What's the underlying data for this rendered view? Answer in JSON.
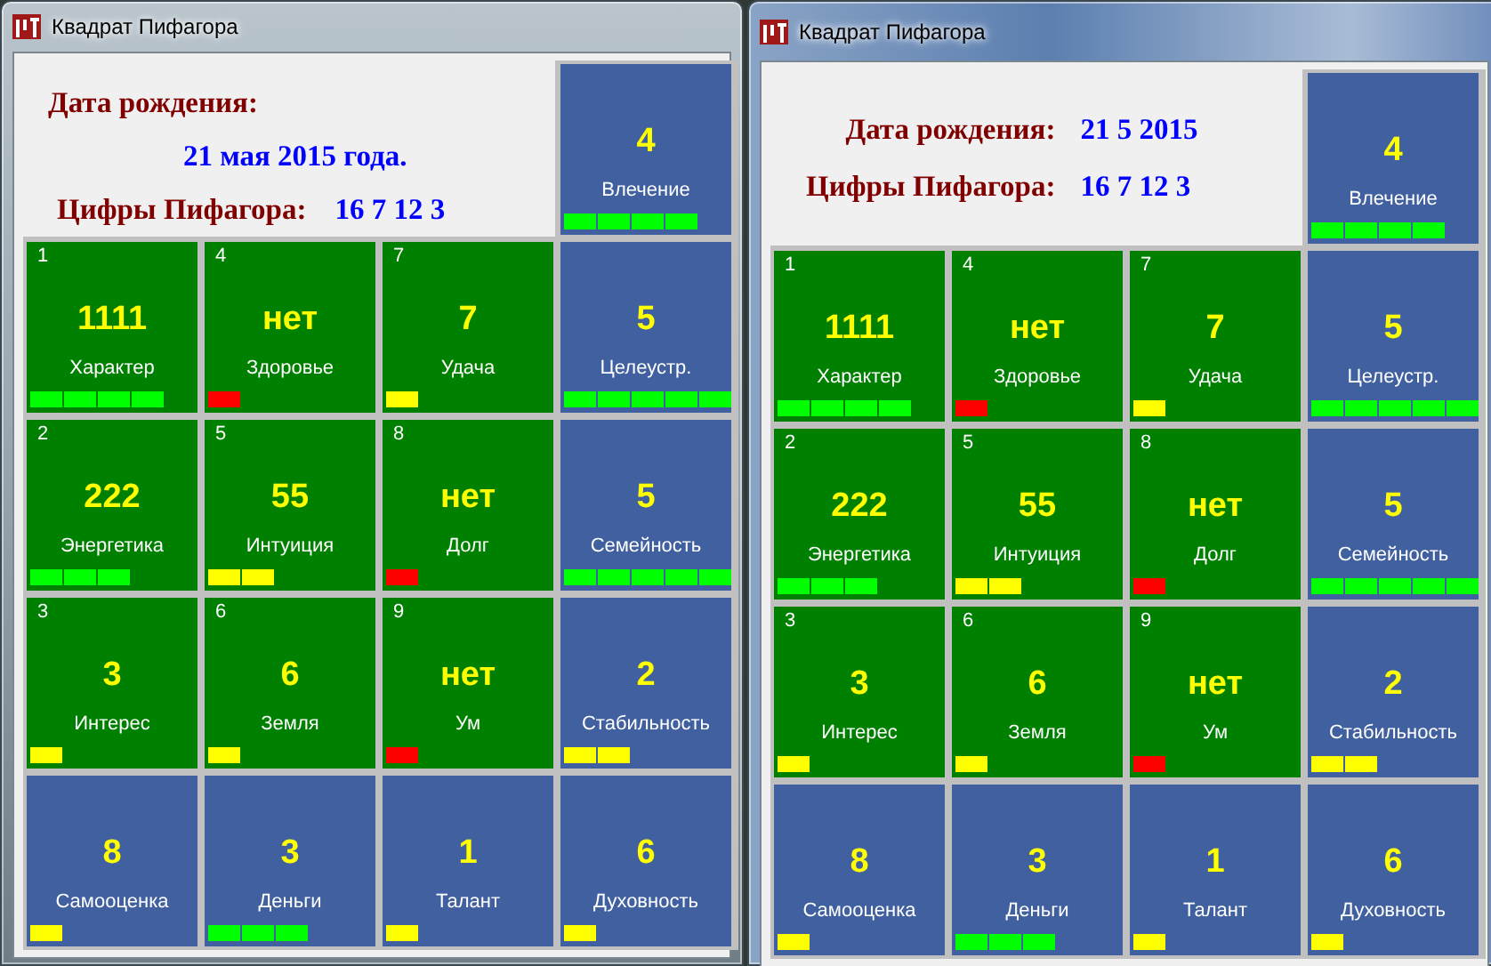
{
  "windows": [
    {
      "title": "Квадрат Пифагора",
      "active": false,
      "header": {
        "kind": "stacked",
        "birth_label": "Дата рождения:",
        "birth_value": "21 мая 2015 года.",
        "digits_label": "Цифры Пифагора:",
        "digits_value": "16 7 12 3"
      },
      "top_tile": {
        "kind": "extra",
        "value": "4",
        "label": "Влечение",
        "segments": [
          {
            "color": "#00ff00"
          },
          {
            "color": "#00ff00"
          },
          {
            "color": "#00ff00"
          },
          {
            "color": "#00ff00"
          }
        ]
      },
      "tiles": [
        {
          "kind": "matrix",
          "index": "1",
          "value": "1111",
          "label": "Характер",
          "segments": [
            {
              "color": "#00ff00"
            },
            {
              "color": "#00ff00"
            },
            {
              "color": "#00ff00"
            },
            {
              "color": "#00ff00"
            }
          ]
        },
        {
          "kind": "matrix",
          "index": "4",
          "value": "нет",
          "label": "Здоровье",
          "segments": [
            {
              "color": "#ff0000"
            }
          ]
        },
        {
          "kind": "matrix",
          "index": "7",
          "value": "7",
          "label": "Удача",
          "segments": [
            {
              "color": "#ffff00"
            }
          ]
        },
        {
          "kind": "extra",
          "value": "5",
          "label": "Целеустр.",
          "segments": [
            {
              "color": "#00ff00"
            },
            {
              "color": "#00ff00"
            },
            {
              "color": "#00ff00"
            },
            {
              "color": "#00ff00"
            },
            {
              "color": "#00ff00"
            }
          ]
        },
        {
          "kind": "matrix",
          "index": "2",
          "value": "222",
          "label": "Энергетика",
          "segments": [
            {
              "color": "#00ff00"
            },
            {
              "color": "#00ff00"
            },
            {
              "color": "#00ff00"
            }
          ]
        },
        {
          "kind": "matrix",
          "index": "5",
          "value": "55",
          "label": "Интуиция",
          "segments": [
            {
              "color": "#ffff00"
            },
            {
              "color": "#ffff00"
            }
          ]
        },
        {
          "kind": "matrix",
          "index": "8",
          "value": "нет",
          "label": "Долг",
          "segments": [
            {
              "color": "#ff0000"
            }
          ]
        },
        {
          "kind": "extra",
          "value": "5",
          "label": "Семейность",
          "segments": [
            {
              "color": "#00ff00"
            },
            {
              "color": "#00ff00"
            },
            {
              "color": "#00ff00"
            },
            {
              "color": "#00ff00"
            },
            {
              "color": "#00ff00"
            }
          ]
        },
        {
          "kind": "matrix",
          "index": "3",
          "value": "3",
          "label": "Интерес",
          "segments": [
            {
              "color": "#ffff00"
            }
          ]
        },
        {
          "kind": "matrix",
          "index": "6",
          "value": "6",
          "label": "Земля",
          "segments": [
            {
              "color": "#ffff00"
            }
          ]
        },
        {
          "kind": "matrix",
          "index": "9",
          "value": "нет",
          "label": "Ум",
          "segments": [
            {
              "color": "#ff0000"
            }
          ]
        },
        {
          "kind": "extra",
          "value": "2",
          "label": "Стабильность",
          "segments": [
            {
              "color": "#ffff00"
            },
            {
              "color": "#ffff00"
            }
          ]
        },
        {
          "kind": "extra",
          "value": "8",
          "label": "Самооценка",
          "segments": [
            {
              "color": "#ffff00"
            }
          ]
        },
        {
          "kind": "extra",
          "value": "3",
          "label": "Деньги",
          "segments": [
            {
              "color": "#00ff00"
            },
            {
              "color": "#00ff00"
            },
            {
              "color": "#00ff00"
            }
          ]
        },
        {
          "kind": "extra",
          "value": "1",
          "label": "Талант",
          "segments": [
            {
              "color": "#ffff00"
            }
          ]
        },
        {
          "kind": "extra",
          "value": "6",
          "label": "Духовность",
          "segments": [
            {
              "color": "#ffff00"
            }
          ]
        }
      ]
    },
    {
      "title": "Квадрат Пифагора",
      "active": true,
      "header": {
        "kind": "inline",
        "birth_label": "Дата рождения:",
        "birth_value": "21 5 2015",
        "digits_label": "Цифры Пифагора:",
        "digits_value": "16 7 12 3"
      },
      "top_tile": {
        "kind": "extra",
        "value": "4",
        "label": "Влечение",
        "segments": [
          {
            "color": "#00ff00"
          },
          {
            "color": "#00ff00"
          },
          {
            "color": "#00ff00"
          },
          {
            "color": "#00ff00"
          }
        ]
      },
      "tiles": [
        {
          "kind": "matrix",
          "index": "1",
          "value": "1111",
          "label": "Характер",
          "segments": [
            {
              "color": "#00ff00"
            },
            {
              "color": "#00ff00"
            },
            {
              "color": "#00ff00"
            },
            {
              "color": "#00ff00"
            }
          ]
        },
        {
          "kind": "matrix",
          "index": "4",
          "value": "нет",
          "label": "Здоровье",
          "segments": [
            {
              "color": "#ff0000"
            }
          ]
        },
        {
          "kind": "matrix",
          "index": "7",
          "value": "7",
          "label": "Удача",
          "segments": [
            {
              "color": "#ffff00"
            }
          ]
        },
        {
          "kind": "extra",
          "value": "5",
          "label": "Целеустр.",
          "segments": [
            {
              "color": "#00ff00"
            },
            {
              "color": "#00ff00"
            },
            {
              "color": "#00ff00"
            },
            {
              "color": "#00ff00"
            },
            {
              "color": "#00ff00"
            }
          ]
        },
        {
          "kind": "matrix",
          "index": "2",
          "value": "222",
          "label": "Энергетика",
          "segments": [
            {
              "color": "#00ff00"
            },
            {
              "color": "#00ff00"
            },
            {
              "color": "#00ff00"
            }
          ]
        },
        {
          "kind": "matrix",
          "index": "5",
          "value": "55",
          "label": "Интуиция",
          "segments": [
            {
              "color": "#ffff00"
            },
            {
              "color": "#ffff00"
            }
          ]
        },
        {
          "kind": "matrix",
          "index": "8",
          "value": "нет",
          "label": "Долг",
          "segments": [
            {
              "color": "#ff0000"
            }
          ]
        },
        {
          "kind": "extra",
          "value": "5",
          "label": "Семейность",
          "segments": [
            {
              "color": "#00ff00"
            },
            {
              "color": "#00ff00"
            },
            {
              "color": "#00ff00"
            },
            {
              "color": "#00ff00"
            },
            {
              "color": "#00ff00"
            }
          ]
        },
        {
          "kind": "matrix",
          "index": "3",
          "value": "3",
          "label": "Интерес",
          "segments": [
            {
              "color": "#ffff00"
            }
          ]
        },
        {
          "kind": "matrix",
          "index": "6",
          "value": "6",
          "label": "Земля",
          "segments": [
            {
              "color": "#ffff00"
            }
          ]
        },
        {
          "kind": "matrix",
          "index": "9",
          "value": "нет",
          "label": "Ум",
          "segments": [
            {
              "color": "#ff0000"
            }
          ]
        },
        {
          "kind": "extra",
          "value": "2",
          "label": "Стабильность",
          "segments": [
            {
              "color": "#ffff00"
            },
            {
              "color": "#ffff00"
            }
          ]
        },
        {
          "kind": "extra",
          "value": "8",
          "label": "Самооценка",
          "segments": [
            {
              "color": "#ffff00"
            }
          ]
        },
        {
          "kind": "extra",
          "value": "3",
          "label": "Деньги",
          "segments": [
            {
              "color": "#00ff00"
            },
            {
              "color": "#00ff00"
            },
            {
              "color": "#00ff00"
            }
          ]
        },
        {
          "kind": "extra",
          "value": "1",
          "label": "Талант",
          "segments": [
            {
              "color": "#ffff00"
            }
          ]
        },
        {
          "kind": "extra",
          "value": "6",
          "label": "Духовность",
          "segments": [
            {
              "color": "#ffff00"
            }
          ]
        }
      ]
    }
  ]
}
